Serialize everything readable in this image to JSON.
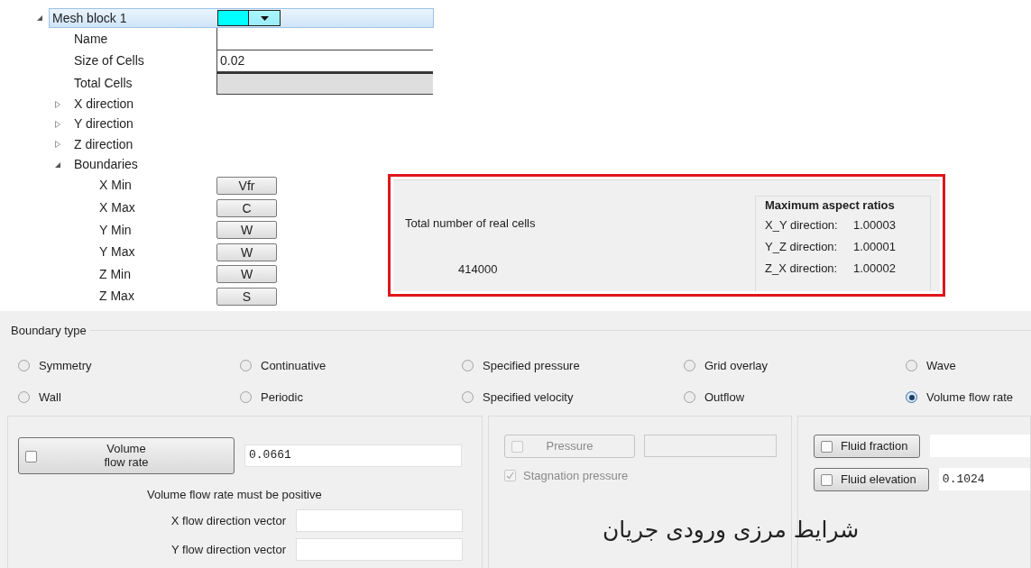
{
  "mesh_tree": {
    "label": "Mesh block 1",
    "expanded": true,
    "selected": true,
    "color": "#00ffff",
    "properties": [
      {
        "label": "Name",
        "disabled": false
      },
      {
        "label": "Size of Cells",
        "value": "0.02",
        "disabled": false
      },
      {
        "label": "Total Cells",
        "disabled": true
      }
    ],
    "children": [
      {
        "label": "X direction",
        "expanded": false
      },
      {
        "label": "Y direction",
        "expanded": false
      },
      {
        "label": "Z direction",
        "expanded": false
      },
      {
        "label": "Boundaries",
        "expanded": true,
        "children": [
          {
            "label": "X Min",
            "button": "Vfr"
          },
          {
            "label": "X Max",
            "button": "C"
          },
          {
            "label": "Y Min",
            "button": "W"
          },
          {
            "label": "Y Max",
            "button": "W"
          },
          {
            "label": "Z Min",
            "button": "W"
          },
          {
            "label": "Z Max",
            "button": "S"
          }
        ]
      }
    ]
  },
  "mesh_summary": {
    "total_label": "Total number of real cells",
    "total_value": "414000",
    "ratios_title": "Maximum aspect ratios",
    "ratios": [
      {
        "label": "X_Y direction:",
        "value": "1.00003"
      },
      {
        "label": "Y_Z direction:",
        "value": "1.00001"
      },
      {
        "label": "Z_X direction:",
        "value": "1.00002"
      }
    ]
  },
  "boundary_type": {
    "title": "Boundary type",
    "options": [
      {
        "label": "Symmetry",
        "selected": false
      },
      {
        "label": "Continuative",
        "selected": false
      },
      {
        "label": "Specified pressure",
        "selected": false
      },
      {
        "label": "Grid overlay",
        "selected": false
      },
      {
        "label": "Wave",
        "selected": false
      },
      {
        "label": "Wall",
        "selected": false
      },
      {
        "label": "Periodic",
        "selected": false
      },
      {
        "label": "Specified velocity",
        "selected": false
      },
      {
        "label": "Outflow",
        "selected": false
      },
      {
        "label": "Volume flow rate",
        "selected": true
      }
    ]
  },
  "flow_panel": {
    "button": "Volume flow rate",
    "checked": false,
    "value": "0.0661",
    "note": "Volume flow rate must be positive",
    "vectors": [
      {
        "label": "X flow direction vector"
      },
      {
        "label": "Y flow direction vector"
      }
    ]
  },
  "pressure_panel": {
    "button": "Pressure",
    "checked": false,
    "disabled": true,
    "stagnation": {
      "label": "Stagnation pressure",
      "checked": true,
      "disabled": true
    }
  },
  "fluid_panel": [
    {
      "button": "Fluid fraction",
      "checked": false
    },
    {
      "button": "Fluid elevation",
      "checked": false,
      "value": "0.1024"
    }
  ],
  "caption": "شرایط مرزی ورودی جریان"
}
